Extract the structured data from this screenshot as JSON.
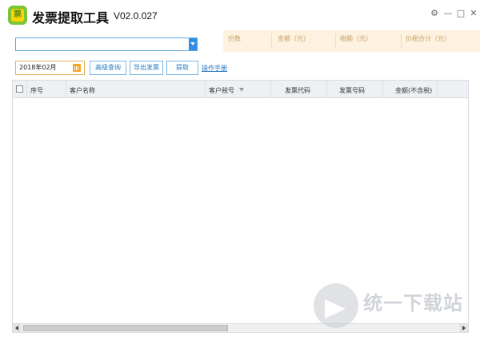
{
  "window": {
    "title": "发票提取工具",
    "version": "V02.0.027",
    "controls": {
      "settings": "⚙",
      "minimize": "—",
      "maximize": "□",
      "close": "✕"
    }
  },
  "summary": {
    "count_label": "份数",
    "amount_label": "金额（元）",
    "tax_label": "税额（元）",
    "total_label": "价税合计（元）"
  },
  "toolbar": {
    "date_value": "2018年02月",
    "advanced_query": "高级查询",
    "export_invoice": "导出发票",
    "extract": "提取",
    "manual_link": "操作手册"
  },
  "table": {
    "columns": [
      "序号",
      "客户名称",
      "客户税号",
      "发票代码",
      "发票号码",
      "金额(不含税)"
    ],
    "rows": []
  },
  "watermark": {
    "text": "统一下载站"
  },
  "colors": {
    "accent": "#2e8ee6",
    "summary_bg": "#fdf2e0",
    "logo": "#7cc43a"
  }
}
